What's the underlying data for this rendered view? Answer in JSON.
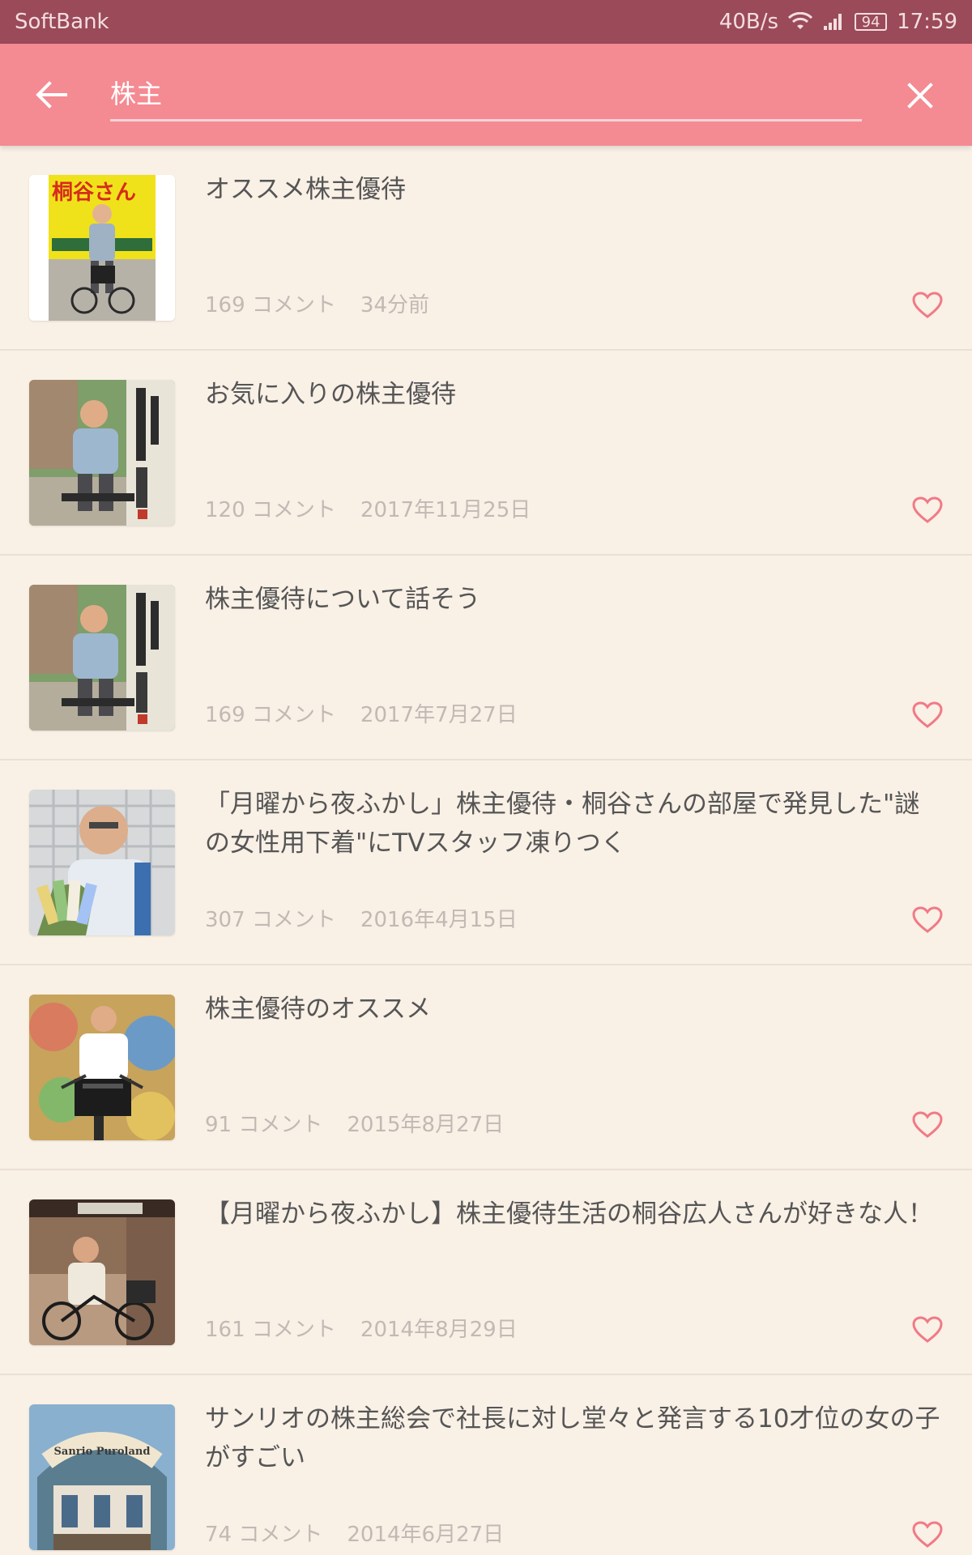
{
  "status_bar": {
    "carrier": "SoftBank",
    "speed": "40B/s",
    "battery": "94",
    "time": "17:59"
  },
  "search": {
    "query": "株主"
  },
  "icons": {
    "back": "arrow-left-icon",
    "clear": "close-icon",
    "favorite": "heart-outline-icon"
  },
  "colors": {
    "status_bar": "#9a4a58",
    "app_bar": "#f48a92",
    "background": "#f9f0e6",
    "accent_heart": "#f07a86",
    "title_text": "#555555",
    "meta_text": "#c1bab4"
  },
  "results": [
    {
      "title": "オススメ株主優待",
      "comments": "169 コメント",
      "date": "34分前",
      "thumbnail_text": "桐谷さん"
    },
    {
      "title": "お気に入りの株主優待",
      "comments": "120 コメント",
      "date": "2017年11月25日"
    },
    {
      "title": "株主優待について話そう",
      "comments": "169 コメント",
      "date": "2017年7月27日"
    },
    {
      "title": "「月曜から夜ふかし」株主優待・桐谷さんの部屋で発見した\"謎の女性用下着\"にTVスタッフ凍りつく",
      "comments": "307 コメント",
      "date": "2016年4月15日"
    },
    {
      "title": "株主優待のオススメ",
      "comments": "91 コメント",
      "date": "2015年8月27日"
    },
    {
      "title": "【月曜から夜ふかし】株主優待生活の桐谷広人さんが好きな人！",
      "comments": "161 コメント",
      "date": "2014年8月29日"
    },
    {
      "title": "サンリオの株主総会で社長に対し堂々と発言する10才位の女の子がすごい",
      "comments": "74 コメント",
      "date": "2014年6月27日",
      "thumbnail_text": "Sanrio Puroland"
    }
  ]
}
